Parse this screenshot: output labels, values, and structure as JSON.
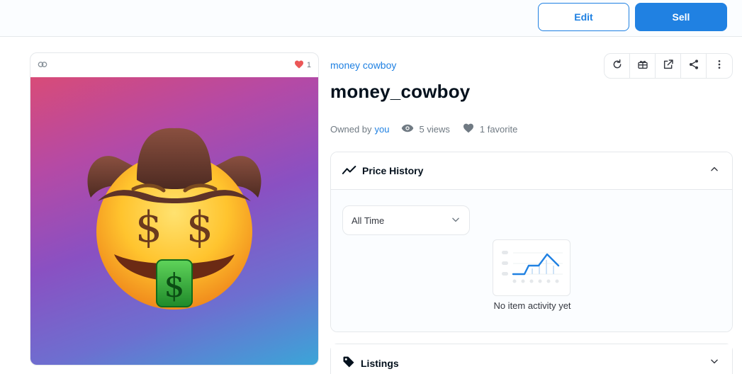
{
  "toolbar": {
    "edit_label": "Edit",
    "sell_label": "Sell"
  },
  "nft_card": {
    "favorites_count": "1"
  },
  "item": {
    "collection_name": "money cowboy",
    "title": "money_cowboy",
    "owned_by_label": "Owned by",
    "owner": "you",
    "views": "5 views",
    "favorites": "1 favorite"
  },
  "price_history": {
    "title": "Price History",
    "time_filter": "All Time",
    "empty_message": "No item activity yet"
  },
  "listings": {
    "title": "Listings"
  },
  "colors": {
    "accent": "#2081e2",
    "heart": "#eb5757",
    "text_dark": "#04111d",
    "muted": "#707a83"
  }
}
